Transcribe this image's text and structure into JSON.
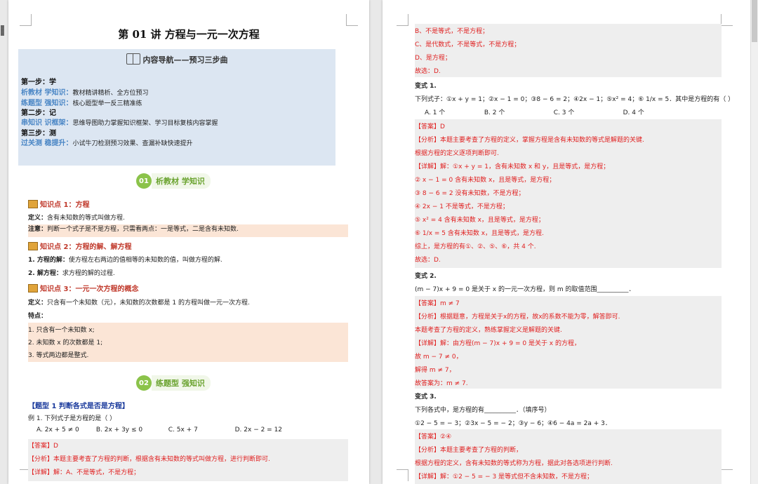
{
  "left_page": {
    "title": "第 01 讲 方程与一元一次方程",
    "nav_header": "内容导航——预习三步曲",
    "steps": [
      {
        "title": "第一步：学"
      },
      {
        "key": "析教材 学知识：",
        "desc": "教材精讲精析、全方位预习"
      },
      {
        "key": "练题型 强知识：",
        "desc": "核心题型举一反三精准练"
      },
      {
        "title": "第二步：记"
      },
      {
        "key": "串知识 识框架：",
        "desc": "思维导图助力掌握知识框架、学习目标复核内容掌握"
      },
      {
        "title": "第三步：测"
      },
      {
        "key": "过关测 稳提升：",
        "desc": "小试牛刀检测预习效果、查漏补缺快速提升"
      }
    ],
    "badge1": {
      "num": "01",
      "text": "析教材 学知识"
    },
    "kp1": "知识点 1：方程",
    "def1_label": "定义：",
    "def1": "含有未知数的等式叫做方程.",
    "note_label": "注意：",
    "note": "判断一个式子是不是方程，只需看两点：一是等式，二是含有未知数.",
    "kp2": "知识点 2：方程的解、解方程",
    "sol1_label": "1. 方程的解：",
    "sol1": "使方程左右两边的值相等的未知数的值，叫做方程的解.",
    "sol2_label": "2. 解方程：",
    "sol2": "求方程的解的过程.",
    "kp3": "知识点 3：一元一次方程的概念",
    "def3_label": "定义：",
    "def3": "只含有一个未知数（元），未知数的次数都是 1 的方程叫做一元一次方程.",
    "feature_label": "特点：",
    "features": [
      "1. 只含有一个未知数 x;",
      "2. 未知数 x 的次数都是 1;",
      "3. 等式两边都是整式."
    ],
    "badge2": {
      "num": "02",
      "text": "练题型 强知识"
    },
    "topic1": "【题型 1 判断各式是否是方程】",
    "ex1": "例 1. 下列式子是方程的是（ ）",
    "ex1_options": [
      "A. 2x + 5 ≠ 0",
      "B. 2x + 3y ≤ 0",
      "C. 5x + 7",
      "D. 2x − 2 = 12"
    ],
    "ex1_answer": "【答案】D",
    "ex1_analysis": "【分析】本题主要考查了方程的判断，根据含有未知数的等式叫做方程，进行判断即可.",
    "ex1_detail": "【详解】解：A、不是等式，不是方程；"
  },
  "right_page": {
    "lines": [
      "B、不是等式，不是方程；",
      "C、是代数式，不是等式，不是方程；",
      "D、是方程；",
      "故选：D."
    ],
    "var1_title": "变式 1.",
    "var1_q": "下列式子：①x + y = 1；②x − 1 = 0；③8 − 6 = 2；④2x − 1；⑤x² = 4；⑥ 1/x = 5．其中是方程的有（ ）",
    "var1_options": [
      "A. 1 个",
      "B. 2 个",
      "C. 3 个",
      "D. 4 个"
    ],
    "var1_answer": "【答案】D",
    "var1_analysis1": "【分析】本题主要考查了方程的定义，掌握方程是含有未知数的等式是解题的关键.",
    "var1_analysis2": "根据方程的定义逐项判断即可.",
    "var1_detail": [
      "【详解】解：①x + y = 1，含有未知数 x 和 y，且是等式，是方程；",
      "② x − 1 = 0 含有未知数 x，且是等式，是方程；",
      "③ 8 − 6 = 2 没有未知数，不是方程；",
      "④ 2x − 1 不是等式，不是方程；",
      "⑤ x² = 4 含有未知数 x，且是等式，是方程；",
      "⑥ 1/x = 5 含有未知数 x，且是等式，是方程.",
      "综上，是方程的有①、②、⑤、⑥，共 4 个.",
      "故选：D."
    ],
    "var2_title": "变式 2.",
    "var2_q": "(m − 7)x + 9 = 0 是关于 x 的一元一次方程，则 m 的取值范围__________．",
    "var2_answer": "【答案】m ≠ 7",
    "var2_analysis1": "【分析】根据题意，方程是关于x的方程，故x的系数不能为零，解答即可.",
    "var2_analysis2": "本题考查了方程的定义，熟练掌握定义是解题的关键.",
    "var2_detail": [
      "【详解】解：由方程(m − 7)x + 9 = 0 是关于 x 的方程，",
      "故 m − 7 ≠ 0，",
      "解得 m ≠ 7，",
      "故答案为：m ≠ 7."
    ],
    "var3_title": "变式 3.",
    "var3_q": "下列各式中，是方程的有__________．（填序号）",
    "var3_items": "①2 − 5 = − 3；②3x − 5 = − 2；③y − 6；④6 − 4a = 2a + 3．",
    "var3_answer": "【答案】②④",
    "var3_analysis1": "【分析】本题主要考查了方程的判断，",
    "var3_analysis2": "根据方程的定义，含有未知数的等式称为方程，据此对各选项进行判断.",
    "var3_detail": "【详解】解：①2 − 5 = − 3 是等式但不含未知数，不是方程；"
  },
  "colors": {
    "nav_bg": "#dce6f2",
    "shade": "#fbe5d6",
    "answer_gray": "#eeeeee",
    "red": "#e02020",
    "accent_green": "#8bc34a",
    "step_blue": "#4a86c5"
  }
}
